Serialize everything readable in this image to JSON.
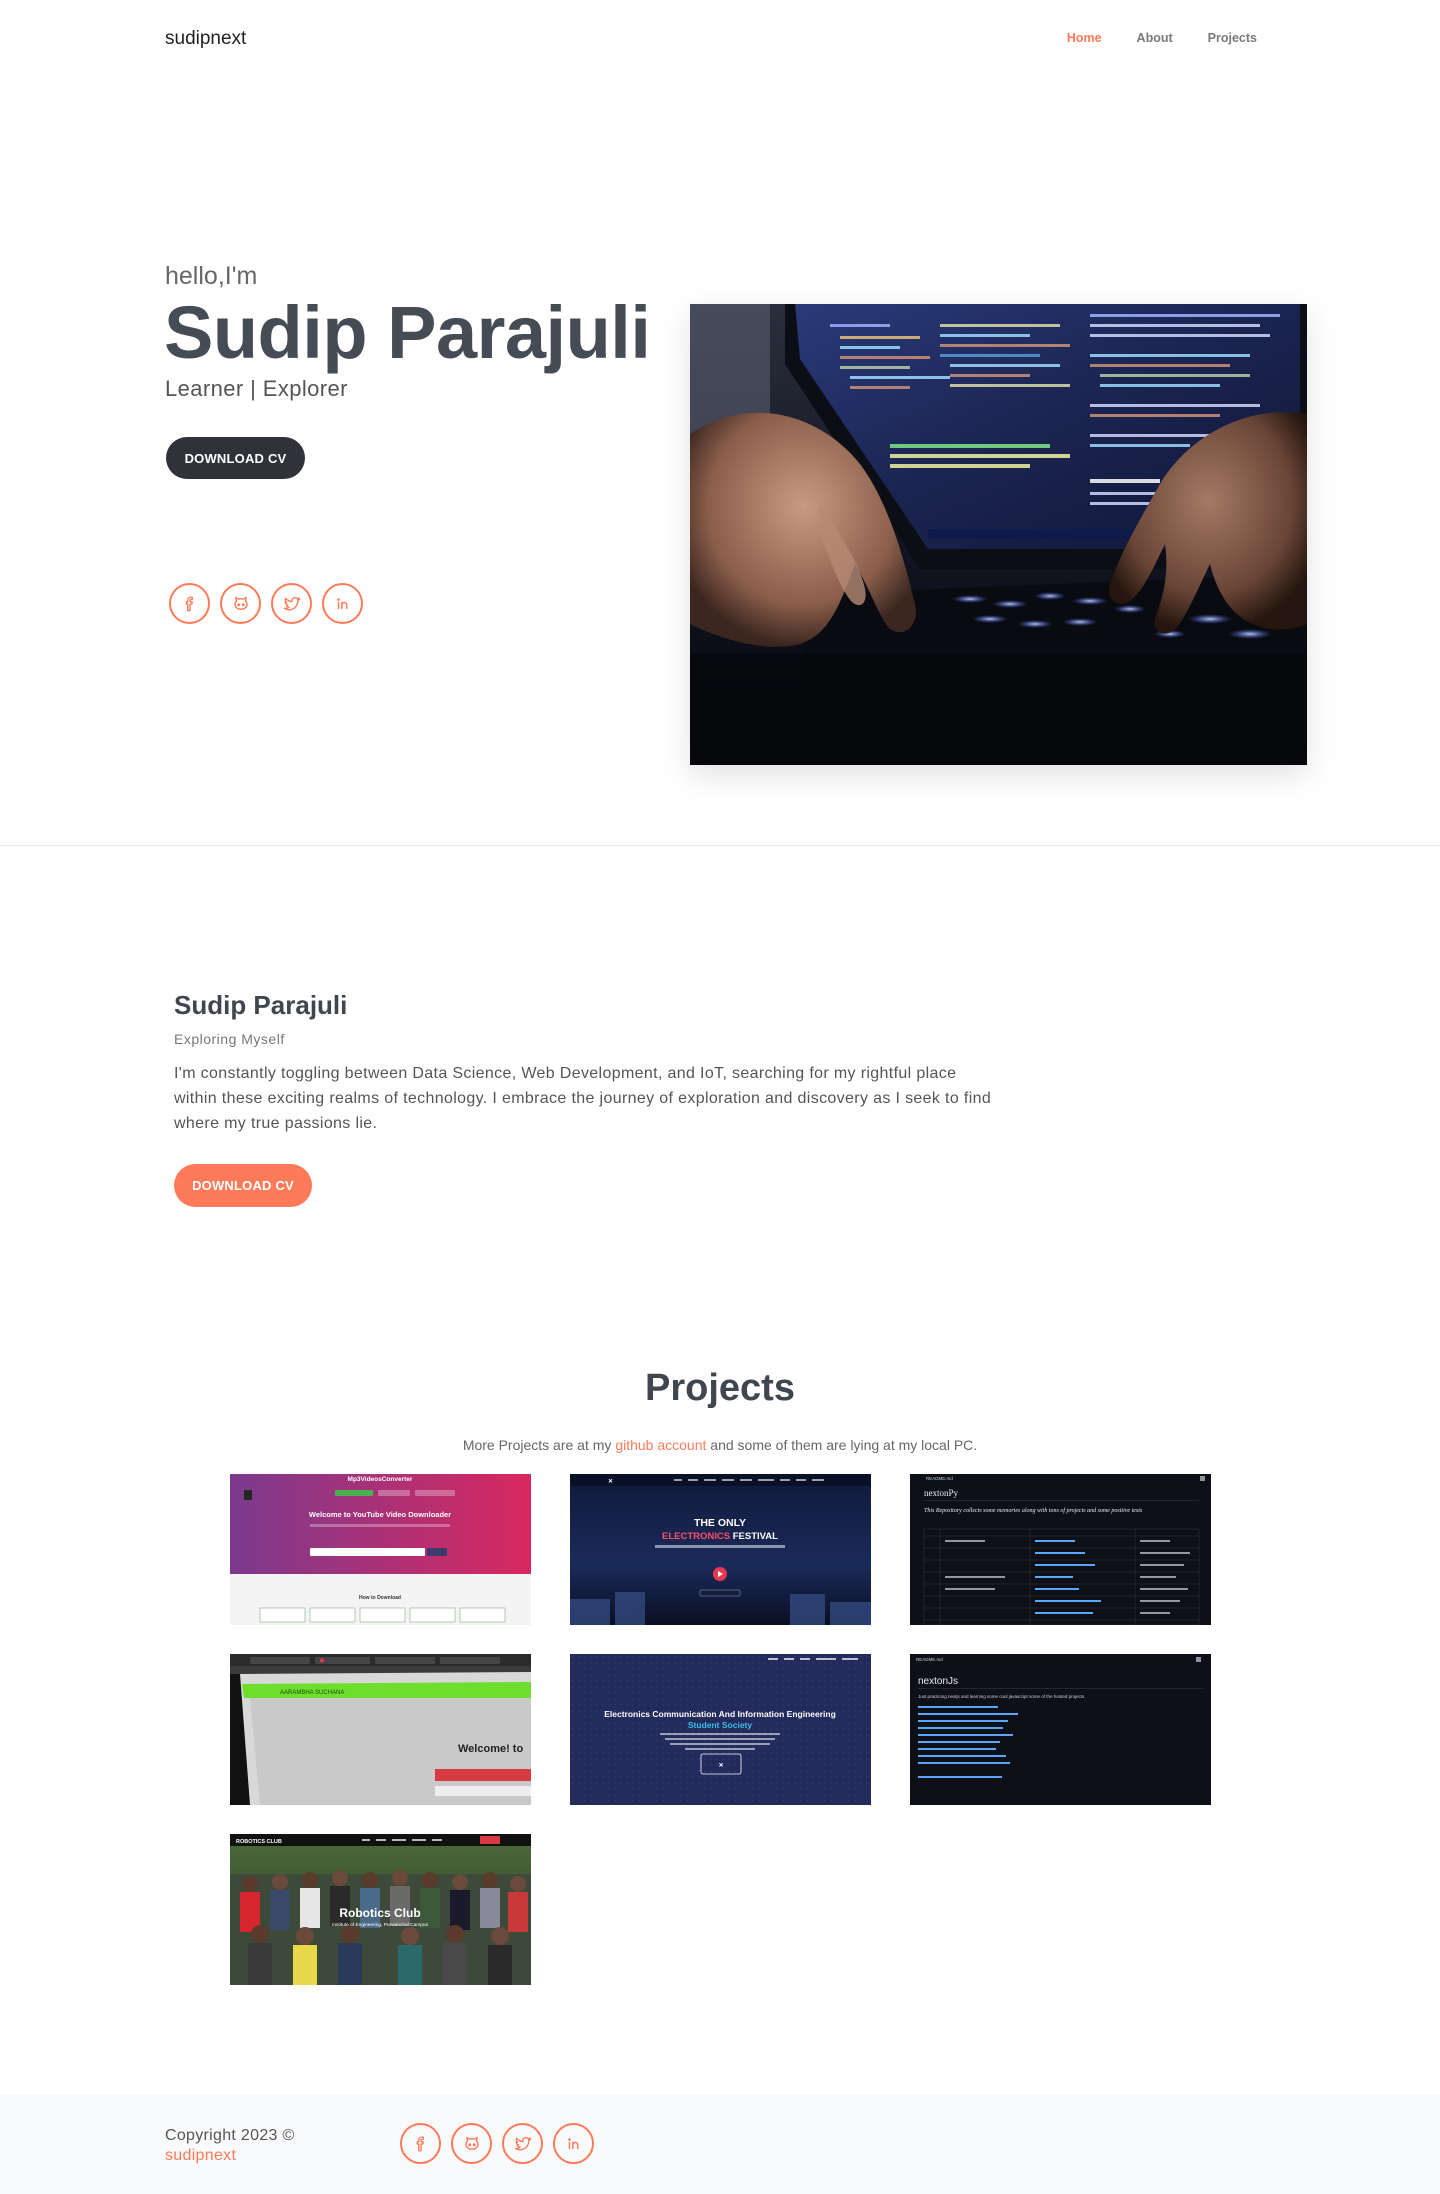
{
  "nav": {
    "brand": "sudipnext",
    "links": [
      {
        "label": "Home",
        "active": true
      },
      {
        "label": "About",
        "active": false
      },
      {
        "label": "Projects",
        "active": false
      }
    ]
  },
  "hero": {
    "greeting": "hello,I'm",
    "name": "Sudip Parajuli",
    "tagline": "Learner | Explorer",
    "cv_button": "DOWNLOAD CV",
    "social_icons": [
      "facebook-icon",
      "github-icon",
      "twitter-icon",
      "linkedin-icon"
    ]
  },
  "about": {
    "name": "Sudip Parajuli",
    "subtitle": "Exploring Myself",
    "text": "I'm constantly toggling between Data Science, Web Development, and IoT, searching for my rightful place within these exciting realms of technology. I embrace the journey of exploration and discovery as I seek to find where my true passions lie.",
    "cv_button": "DOWNLOAD CV"
  },
  "projects": {
    "title": "Projects",
    "desc_before": "More Projects are at my ",
    "desc_link": "github account",
    "desc_after": " and some of them are lying at my local PC.",
    "cards": [
      {
        "heading": "Mp3VideosConverter",
        "title": "Welcome to YouTube Video Downloader",
        "footer": "How to Download"
      },
      {
        "title": "THE ONLY",
        "highlight": "ELECTRONICS",
        "title_end": " FESTIVAL"
      },
      {
        "filename": "README.md",
        "title": "nextonPy",
        "subtitle": "This Repository collects some memories along with tons of projects and some positive tests"
      },
      {
        "label": "AARAMBHA SUCHANA",
        "title": "Welcome! to"
      },
      {
        "title": "Electronics Communication And Information Engineering",
        "subtitle": "Student Society"
      },
      {
        "filename": "README.md",
        "title": "nextonJs",
        "subtitle": "Just practicing nextjs and learning some cool javascript some of the hosted projects"
      },
      {
        "logo": "ROBOTICS CLUB",
        "title": "Robotics Club",
        "subtitle": "Institute of Engineering, Purwanchal Campus"
      }
    ]
  },
  "footer": {
    "copyright": "Copyright 2023 ©",
    "brand": "sudipnext"
  },
  "colors": {
    "accent": "#ff7a59",
    "dark_button": "#2f3339",
    "heading": "#454c55"
  }
}
